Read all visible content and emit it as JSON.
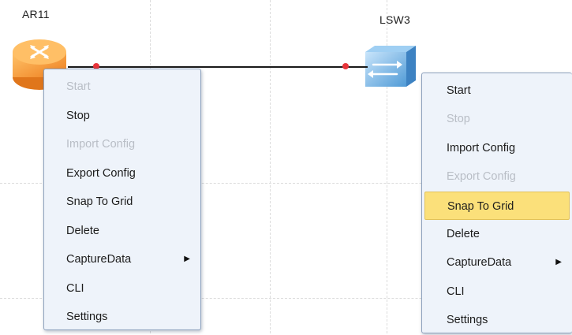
{
  "devices": {
    "router": {
      "name": "AR11"
    },
    "switch": {
      "name": "LSW3"
    }
  },
  "icons": {
    "router": "router-icon",
    "switch": "switch-icon",
    "submenu": "triangle-right-icon"
  },
  "colors": {
    "router_orange": "#f39a38",
    "switch_blue": "#6fb1e6",
    "link_line": "#1a1a1a",
    "port_dot": "#e8343a",
    "menu_bg": "#eef3fa",
    "menu_highlight": "#fbe07a",
    "disabled_text": "#b9bec6"
  },
  "left_menu": {
    "items": [
      {
        "label": "Start",
        "enabled": false
      },
      {
        "label": "Stop",
        "enabled": true
      },
      {
        "label": "Import Config",
        "enabled": false
      },
      {
        "label": "Export Config",
        "enabled": true
      },
      {
        "label": "Snap To Grid",
        "enabled": true
      },
      {
        "label": "Delete",
        "enabled": true
      },
      {
        "label": "CaptureData",
        "enabled": true,
        "submenu": true
      },
      {
        "label": "CLI",
        "enabled": true
      },
      {
        "label": "Settings",
        "enabled": true
      }
    ]
  },
  "right_menu": {
    "items": [
      {
        "label": "Start",
        "enabled": true
      },
      {
        "label": "Stop",
        "enabled": false
      },
      {
        "label": "Import Config",
        "enabled": true
      },
      {
        "label": "Export Config",
        "enabled": false
      },
      {
        "label": "Snap To Grid",
        "enabled": true,
        "highlighted": true
      },
      {
        "label": "Delete",
        "enabled": true
      },
      {
        "label": "CaptureData",
        "enabled": true,
        "submenu": true
      },
      {
        "label": "CLI",
        "enabled": true
      },
      {
        "label": "Settings",
        "enabled": true
      }
    ]
  }
}
